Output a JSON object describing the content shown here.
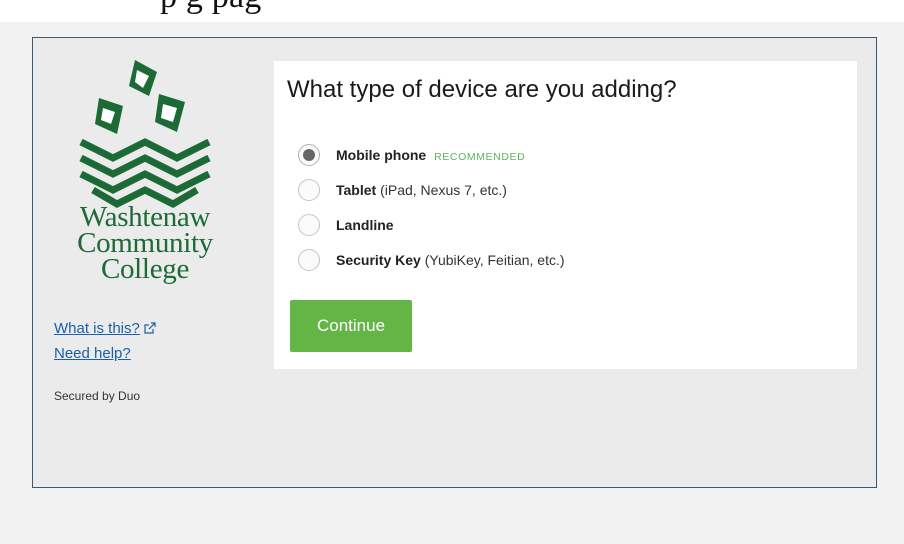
{
  "header": {
    "partial_text": "p                                          g pag"
  },
  "sidebar": {
    "logo": {
      "name_lines": [
        "Washtenaw",
        "Community",
        "College"
      ],
      "brand_color": "#1c6a36"
    },
    "links": {
      "what_is_this": "What is this?",
      "need_help": "Need help?"
    },
    "secured_by": "Secured by Duo"
  },
  "main": {
    "title": "What type of device are you adding?",
    "options": [
      {
        "label": "Mobile phone",
        "desc": "",
        "badge": "RECOMMENDED",
        "checked": true
      },
      {
        "label": "Tablet",
        "desc": "(iPad, Nexus 7, etc.)",
        "badge": "",
        "checked": false
      },
      {
        "label": "Landline",
        "desc": "",
        "badge": "",
        "checked": false
      },
      {
        "label": "Security Key",
        "desc": "(YubiKey, Feitian, etc.)",
        "badge": "",
        "checked": false
      }
    ],
    "continue_label": "Continue"
  },
  "colors": {
    "accent_green": "#63b545",
    "recommended_green": "#5bb55e",
    "link_blue": "#1a5fa8",
    "frame_border": "#3a5a78"
  }
}
